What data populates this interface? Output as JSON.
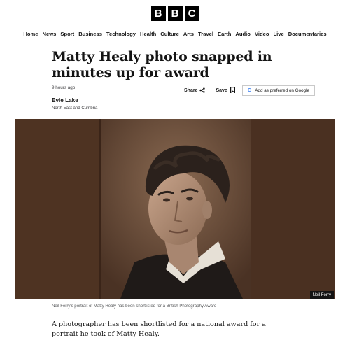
{
  "logo": {
    "letters": [
      "B",
      "B",
      "C"
    ]
  },
  "nav": {
    "items": [
      "Home",
      "News",
      "Sport",
      "Business",
      "Technology",
      "Health",
      "Culture",
      "Arts",
      "Travel",
      "Earth",
      "Audio",
      "Video",
      "Live",
      "Documentaries"
    ]
  },
  "article": {
    "headline": "Matty Healy photo snapped in minutes up for award",
    "timestamp": "9 hours ago",
    "share_label": "Share",
    "save_label": "Save",
    "google_label": "Add as preferred on Google",
    "author_name": "Evie Lake",
    "author_role": "North East and Cumbria",
    "photo_credit": "Neil Ferry",
    "caption": "Neil Ferry's portrait of Matty Healy has been shortlisted for a British Photography Award",
    "intro": "A photographer has been shortlisted for a national award for a portrait he took of Matty Healy."
  },
  "icons": {
    "share": "share-icon",
    "save": "bookmark-icon",
    "google": "google-g-icon"
  }
}
